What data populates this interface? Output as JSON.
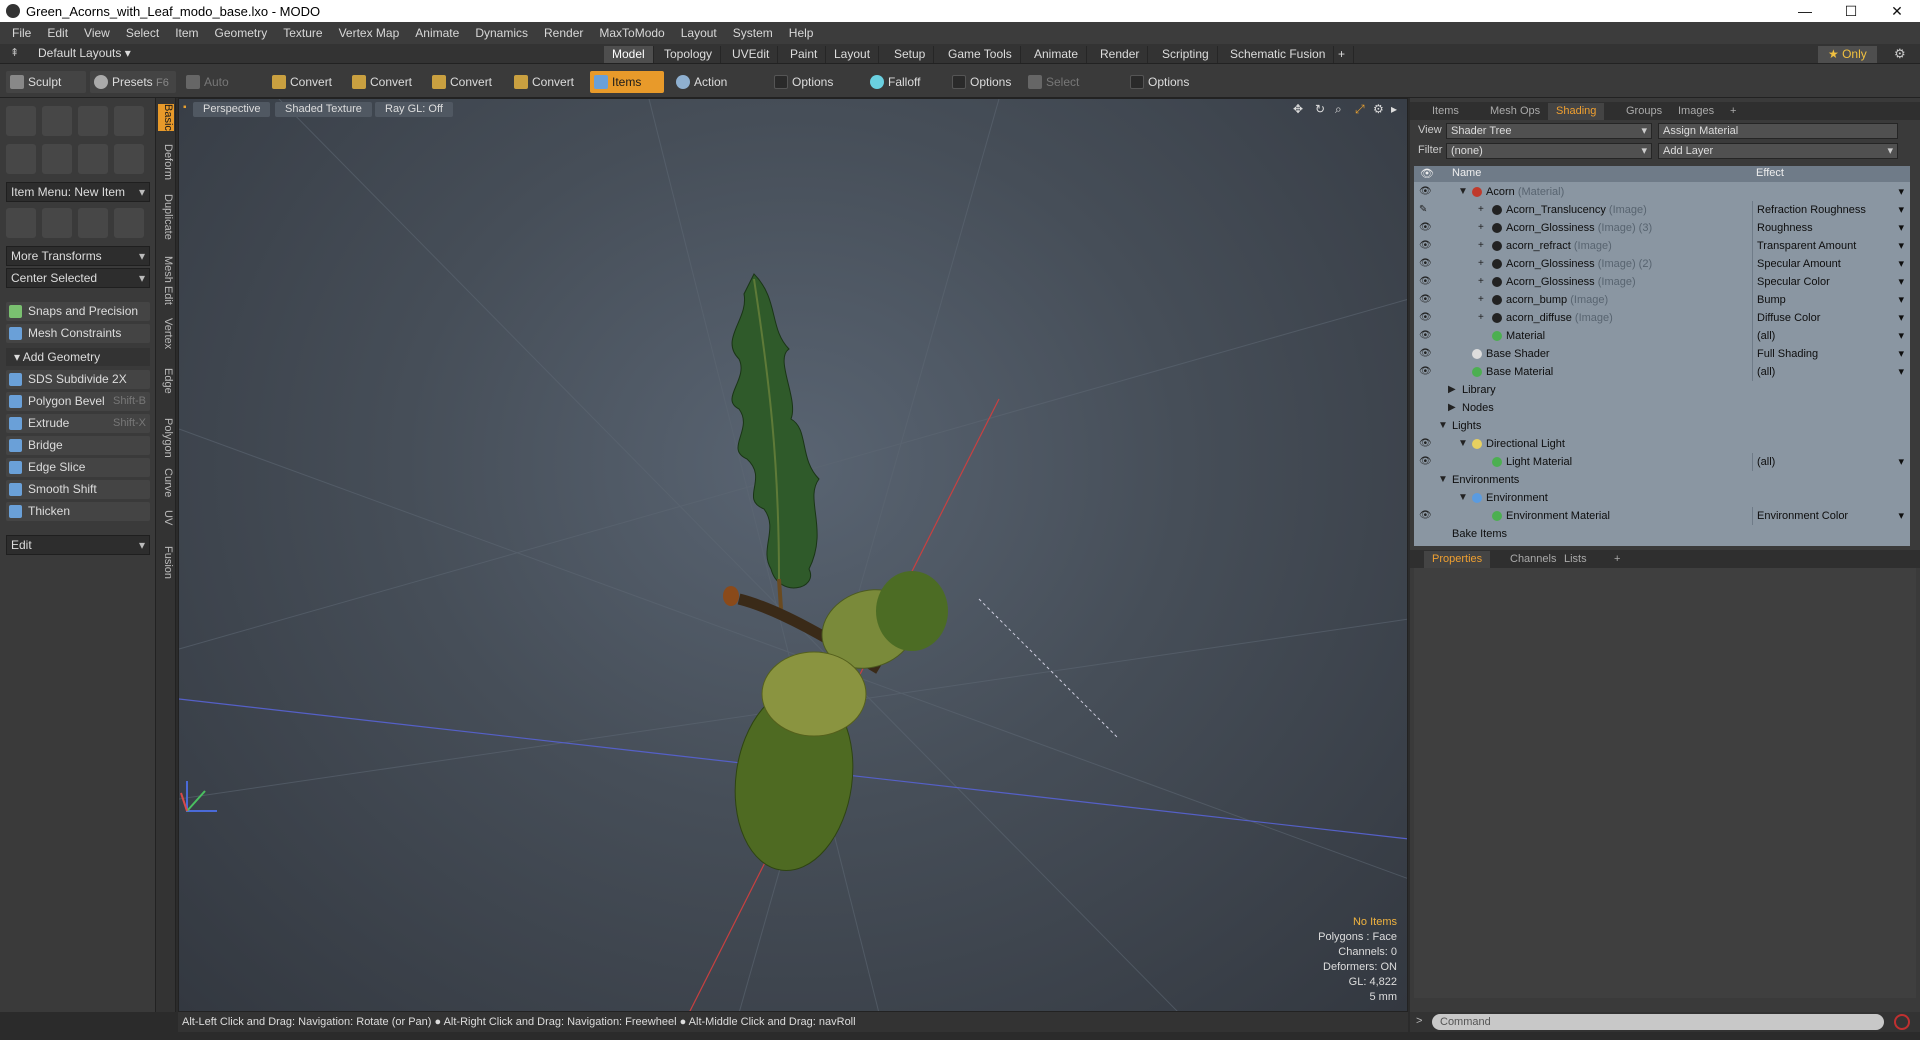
{
  "window": {
    "title": "Green_Acorns_with_Leaf_modo_base.lxo - MODO"
  },
  "menu": [
    "File",
    "Edit",
    "View",
    "Select",
    "Item",
    "Geometry",
    "Texture",
    "Vertex Map",
    "Animate",
    "Dynamics",
    "Render",
    "MaxToModo",
    "Layout",
    "System",
    "Help"
  ],
  "layout": {
    "default": "Default Layouts ▾",
    "tabs": [
      "Model",
      "Topology",
      "UVEdit",
      "Paint",
      "Layout",
      "Setup",
      "Game Tools",
      "Animate",
      "Render",
      "Scripting",
      "Schematic Fusion",
      "+"
    ],
    "active_tab": "Model",
    "only": "★  Only"
  },
  "toolbar": {
    "sculpt": "Sculpt",
    "presets": "Presets",
    "presets_key": "F6",
    "auto_select": "Auto Select",
    "convert1": "Convert",
    "convert2": "Convert",
    "convert3": "Convert",
    "convert4": "Convert",
    "items": "Items",
    "action_center": "Action Center",
    "options1": "Options",
    "falloff": "Falloff",
    "options2": "Options",
    "select_through": "Select Through",
    "options3": "Options"
  },
  "left": {
    "item_menu": "Item Menu: New Item",
    "more_transforms": "More Transforms",
    "center_selected": "Center Selected",
    "snaps": "Snaps and Precision",
    "mesh_constraints": "Mesh Constraints",
    "add_geometry": "Add Geometry",
    "tools": [
      {
        "label": "SDS Subdivide 2X",
        "key": ""
      },
      {
        "label": "Polygon Bevel",
        "key": "Shift-B"
      },
      {
        "label": "Extrude",
        "key": "Shift-X"
      },
      {
        "label": "Bridge",
        "key": ""
      },
      {
        "label": "Edge Slice",
        "key": ""
      },
      {
        "label": "Smooth Shift",
        "key": ""
      },
      {
        "label": "Thicken",
        "key": ""
      }
    ],
    "edit": "Edit"
  },
  "vtabs": [
    "Basic",
    "Deform",
    "Duplicate",
    "Mesh Edit",
    "Vertex",
    "Edge",
    "Polygon",
    "Curve",
    "UV",
    "Fusion"
  ],
  "viewport": {
    "perspective": "Perspective",
    "shaded": "Shaded Texture",
    "raygl": "Ray GL: Off",
    "info": {
      "no_items": "No Items",
      "polygons": "Polygons : Face",
      "channels": "Channels: 0",
      "deformers": "Deformers: ON",
      "gl": "GL: 4,822",
      "size": "5 mm"
    }
  },
  "status": "Alt-Left Click and Drag: Navigation: Rotate (or Pan) ● Alt-Right Click and Drag: Navigation: Freewheel ● Alt-Middle Click and Drag: navRoll",
  "right": {
    "tabs": [
      "Items",
      "Mesh Ops",
      "Shading",
      "Groups",
      "Images",
      "+"
    ],
    "view_label": "View",
    "view_value": "Shader Tree",
    "assign": "Assign Material",
    "filter_label": "Filter",
    "filter_value": "(none)",
    "add_layer": "Add Layer",
    "col_name": "Name",
    "col_effect": "Effect",
    "tree": [
      {
        "name": "Acorn",
        "tag": "(Material)",
        "effect": "",
        "ind": 58,
        "exp": "▼",
        "color": "#c0392b",
        "eye": "👁",
        "arrow": true
      },
      {
        "name": "Acorn_Translucency",
        "tag": "(Image)",
        "effect": "Refraction Roughness",
        "ind": 78,
        "exp": "+",
        "color": "#222",
        "eye": "✎",
        "arrow": true
      },
      {
        "name": "Acorn_Glossiness",
        "tag": "(Image) (3)",
        "effect": "Roughness",
        "ind": 78,
        "exp": "+",
        "color": "#222",
        "eye": "👁",
        "arrow": true
      },
      {
        "name": "acorn_refract",
        "tag": "(Image)",
        "effect": "Transparent Amount",
        "ind": 78,
        "exp": "+",
        "color": "#222",
        "eye": "👁",
        "arrow": true
      },
      {
        "name": "Acorn_Glossiness",
        "tag": "(Image) (2)",
        "effect": "Specular Amount",
        "ind": 78,
        "exp": "+",
        "color": "#222",
        "eye": "👁",
        "arrow": true
      },
      {
        "name": "Acorn_Glossiness",
        "tag": "(Image)",
        "effect": "Specular Color",
        "ind": 78,
        "exp": "+",
        "color": "#222",
        "eye": "👁",
        "arrow": true
      },
      {
        "name": "acorn_bump",
        "tag": "(Image)",
        "effect": "Bump",
        "ind": 78,
        "exp": "+",
        "color": "#222",
        "eye": "👁",
        "arrow": true
      },
      {
        "name": "acorn_diffuse",
        "tag": "(Image)",
        "effect": "Diffuse Color",
        "ind": 78,
        "exp": "+",
        "color": "#222",
        "eye": "👁",
        "arrow": true
      },
      {
        "name": "Material",
        "tag": "",
        "effect": "(all)",
        "ind": 78,
        "exp": "",
        "color": "#4caf50",
        "eye": "👁",
        "arrow": true
      },
      {
        "name": "Base Shader",
        "tag": "",
        "effect": "Full Shading",
        "ind": 58,
        "exp": "",
        "color": "#ddd",
        "eye": "👁",
        "arrow": true
      },
      {
        "name": "Base Material",
        "tag": "",
        "effect": "(all)",
        "ind": 58,
        "exp": "",
        "color": "#4caf50",
        "eye": "👁",
        "arrow": true
      },
      {
        "name": "Library",
        "tag": "",
        "effect": "",
        "ind": 48,
        "exp": "▶",
        "color": "",
        "eye": "",
        "arrow": false
      },
      {
        "name": "Nodes",
        "tag": "",
        "effect": "",
        "ind": 48,
        "exp": "▶",
        "color": "",
        "eye": "",
        "arrow": false
      },
      {
        "name": "Lights",
        "tag": "",
        "effect": "",
        "ind": 38,
        "exp": "▼",
        "color": "",
        "eye": "",
        "arrow": false
      },
      {
        "name": "Directional Light",
        "tag": "",
        "effect": "",
        "ind": 58,
        "exp": "▼",
        "color": "#e8d060",
        "eye": "👁",
        "arrow": false
      },
      {
        "name": "Light Material",
        "tag": "",
        "effect": "(all)",
        "ind": 78,
        "exp": "",
        "color": "#4caf50",
        "eye": "👁",
        "arrow": true
      },
      {
        "name": "Environments",
        "tag": "",
        "effect": "",
        "ind": 38,
        "exp": "▼",
        "color": "",
        "eye": "",
        "arrow": false
      },
      {
        "name": "Environment",
        "tag": "",
        "effect": "",
        "ind": 58,
        "exp": "▼",
        "color": "#5a9be0",
        "eye": "",
        "arrow": false
      },
      {
        "name": "Environment Material",
        "tag": "",
        "effect": "Environment Color",
        "ind": 78,
        "exp": "",
        "color": "#4caf50",
        "eye": "👁",
        "arrow": true
      },
      {
        "name": "Bake Items",
        "tag": "",
        "effect": "",
        "ind": 38,
        "exp": "",
        "color": "",
        "eye": "",
        "arrow": false
      }
    ],
    "prop_tabs": [
      "Properties",
      "Channels",
      "Lists",
      "+"
    ],
    "command": "Command"
  }
}
